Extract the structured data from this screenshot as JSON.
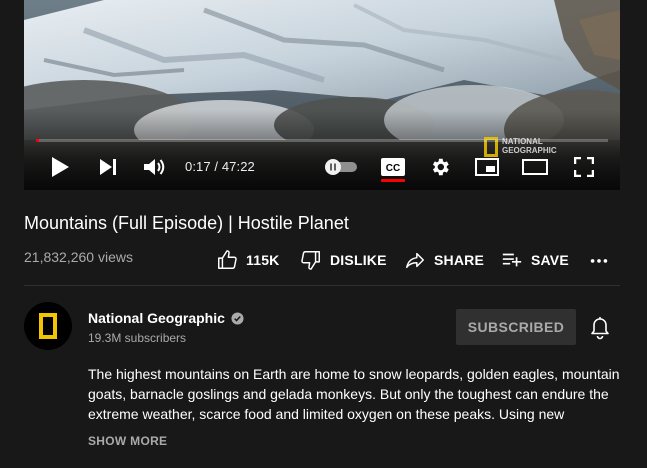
{
  "player": {
    "current_time": "0:17",
    "separator": " / ",
    "duration": "47:22",
    "progress_fraction": 0.006,
    "cc_label": "CC",
    "watermark_line1": "NATIONAL",
    "watermark_line2": "GEOGRAPHIC",
    "icons": [
      "play-icon",
      "next-icon",
      "volume-icon",
      "autoplay-toggle",
      "cc-icon",
      "settings-icon",
      "miniplayer-icon",
      "theater-icon",
      "fullscreen-icon"
    ]
  },
  "video": {
    "title": "Mountains (Full Episode) | Hostile Planet",
    "views": "21,832,260 views"
  },
  "actions": {
    "like_count": "115K",
    "dislike_label": "DISLIKE",
    "share_label": "SHARE",
    "save_label": "SAVE"
  },
  "channel": {
    "name": "National Geographic",
    "subscribers": "19.3M subscribers",
    "subscribe_label": "SUBSCRIBED"
  },
  "description": {
    "text": "The highest mountains on Earth are home to snow leopards, golden eagles, mountain goats, barnacle goslings and gelada monkeys. But only the toughest can endure the extreme weather, scarce food and limited oxygen on these peaks. Using new",
    "show_more": "SHOW MORE"
  },
  "colors": {
    "background": "#181818",
    "accent_red": "#ff0000",
    "natgeo_yellow": "#f2c500",
    "secondary_text": "#aaaaaa",
    "button_bg": "#303030"
  }
}
